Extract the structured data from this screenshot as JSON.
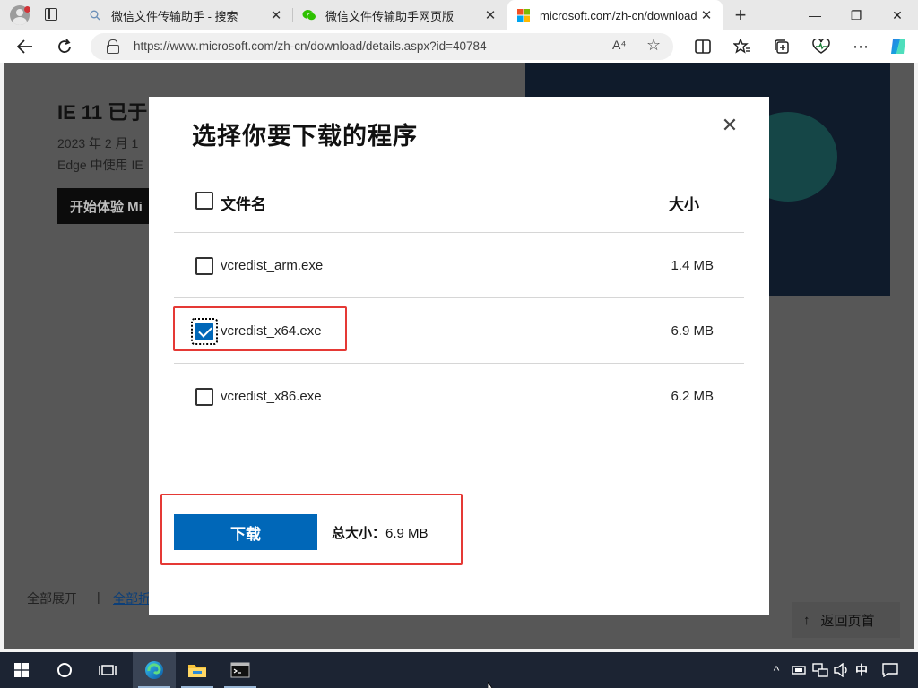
{
  "browser": {
    "tabs": [
      {
        "title": "微信文件传输助手 - 搜索",
        "icon": "search-icon",
        "active": false
      },
      {
        "title": "微信文件传输助手网页版",
        "icon": "wechat-icon",
        "active": false
      },
      {
        "title": "microsoft.com/zh-cn/download/d",
        "icon": "microsoft-logo-icon",
        "active": true
      }
    ],
    "new_tab": "+",
    "url": "https://www.microsoft.com/zh-cn/download/details.aspx?id=40784",
    "read_aloud_label": "A⁴",
    "window_controls": {
      "minimize": "—",
      "maximize": "❐",
      "close": "✕"
    }
  },
  "page": {
    "ie_title": "IE 11 已于",
    "ie_line1": "2023 年 2 月 1",
    "ie_line2": "Edge 中使用 IE",
    "ie_button": "开始体验 Mi",
    "expand_all": "全部展开",
    "separator": "|",
    "collapse_all": "全部折",
    "back_to_top": "返回页首"
  },
  "dialog": {
    "title": "选择你要下载的程序",
    "close": "✕",
    "header": {
      "name": "文件名",
      "size": "大小"
    },
    "files": [
      {
        "name": "vcredist_arm.exe",
        "size": "1.4 MB",
        "checked": false
      },
      {
        "name": "vcredist_x64.exe",
        "size": "6.9 MB",
        "checked": true
      },
      {
        "name": "vcredist_x86.exe",
        "size": "6.2 MB",
        "checked": false
      }
    ],
    "download_button": "下载",
    "total_label": "总大小：",
    "total_value": "6.9 MB"
  },
  "taskbar": {
    "ime": "中",
    "colors": {
      "background": "#1c2433",
      "accent": "#0067b8"
    }
  }
}
